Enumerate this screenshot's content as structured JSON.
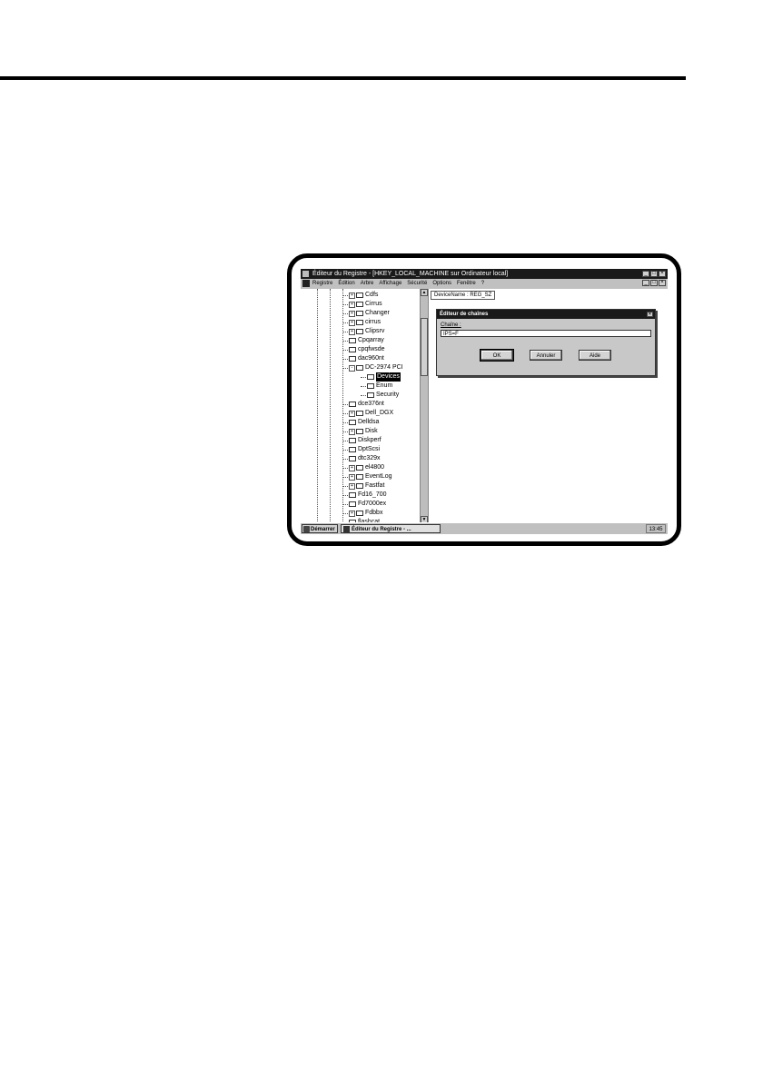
{
  "window": {
    "title": "Éditeur du Registre - [HKEY_LOCAL_MACHINE sur Ordinateur local]",
    "menu": [
      "Registre",
      "Édition",
      "Arbre",
      "Affichage",
      "Sécurité",
      "Options",
      "Fenêtre",
      "?"
    ]
  },
  "tree": {
    "items": [
      {
        "label": "Cdfs",
        "expander": "+"
      },
      {
        "label": "Cirrus",
        "expander": "+"
      },
      {
        "label": "Changer",
        "expander": "+"
      },
      {
        "label": "cirrus",
        "expander": "+"
      },
      {
        "label": "Clipsrv",
        "expander": "+"
      },
      {
        "label": "Cpqarray",
        "expander": ""
      },
      {
        "label": "cpqfwsde",
        "expander": ""
      },
      {
        "label": "dac960nt",
        "expander": ""
      },
      {
        "label": "DC-2974 PCI",
        "expander": "-"
      },
      {
        "label": "Devices",
        "child": true,
        "selected": true
      },
      {
        "label": "Enum",
        "child": true
      },
      {
        "label": "Security",
        "child": true
      },
      {
        "label": "dce376nt",
        "expander": ""
      },
      {
        "label": "Dell_DGX",
        "expander": "+"
      },
      {
        "label": "Delldsa",
        "expander": ""
      },
      {
        "label": "Disk",
        "expander": "+"
      },
      {
        "label": "Diskperf",
        "expander": ""
      },
      {
        "label": "DptScsi",
        "expander": ""
      },
      {
        "label": "dtc329x",
        "expander": ""
      },
      {
        "label": "el4800",
        "expander": "+"
      },
      {
        "label": "EventLog",
        "expander": "+"
      },
      {
        "label": "Fastfat",
        "expander": "+"
      },
      {
        "label": "Fd16_700",
        "expander": ""
      },
      {
        "label": "Fd7000ex",
        "expander": ""
      },
      {
        "label": "Fdbbx",
        "expander": "+"
      },
      {
        "label": "flashcat",
        "expander": ""
      }
    ]
  },
  "value_pane": {
    "entry": "DeviceName : REG_SZ"
  },
  "dialog": {
    "title": "Éditeur de chaînes",
    "field_label": "Chaîne :",
    "field_value": "IPS=F",
    "buttons": {
      "ok": "OK",
      "cancel": "Annuler",
      "help": "Aide"
    }
  },
  "taskbar": {
    "start": "Démarrer",
    "task": "Éditeur du Registre - ...",
    "clock": "13:45"
  }
}
